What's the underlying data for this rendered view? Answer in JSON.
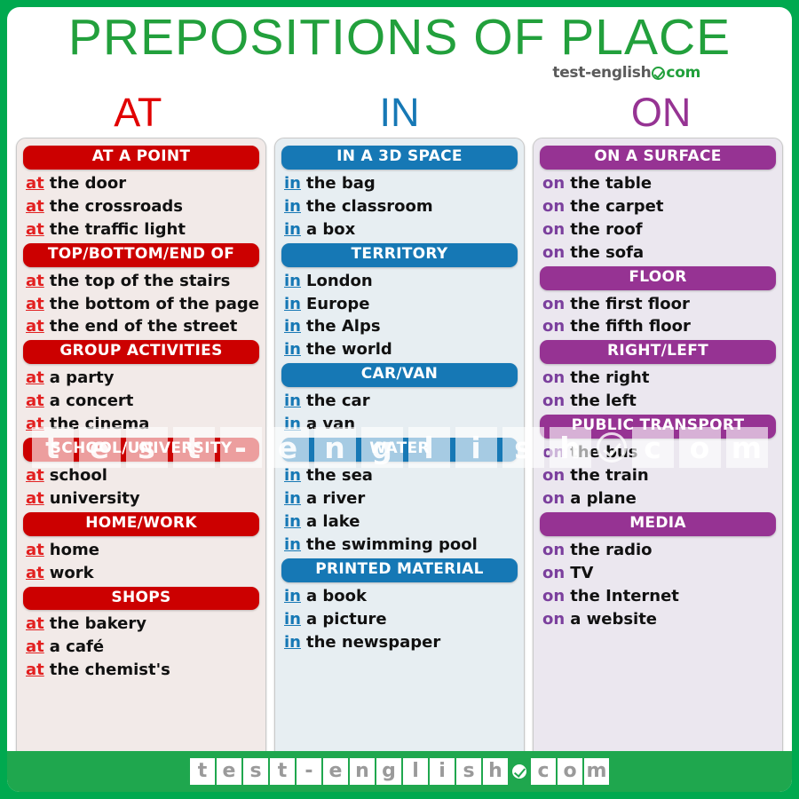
{
  "header": {
    "title": "PREPOSITIONS OF PLACE",
    "logo": {
      "name": "test-english",
      "check_icon": "check-circle-icon",
      "tld": "com"
    },
    "title_color": "#22a03c"
  },
  "columns": [
    {
      "id": "at",
      "title": "AT",
      "title_color": "#e10000",
      "header_color": "#cc0000",
      "panel_color": "#f2eae8",
      "preposition": "at",
      "groups": [
        {
          "header": "AT A POINT",
          "items": [
            "the door",
            "the crossroads",
            "the traffic light"
          ]
        },
        {
          "header": "TOP/BOTTOM/END OF",
          "items": [
            "the top  of the stairs",
            "the bottom of the page",
            "the end of the street"
          ]
        },
        {
          "header": "GROUP ACTIVITIES",
          "items": [
            "a party",
            "a concert",
            "the cinema"
          ]
        },
        {
          "header": "SCHOOL/UNIVERSITY",
          "items": [
            "school",
            "university"
          ]
        },
        {
          "header": "HOME/WORK",
          "items": [
            "home",
            "work"
          ]
        },
        {
          "header": "SHOPS",
          "items": [
            "the bakery",
            "a café",
            "the chemist's"
          ]
        }
      ]
    },
    {
      "id": "in",
      "title": "IN",
      "title_color": "#1678b5",
      "header_color": "#1678b5",
      "panel_color": "#e7eef2",
      "preposition": "in",
      "groups": [
        {
          "header": "IN A 3D SPACE",
          "items": [
            "the bag",
            "the classroom",
            "a box"
          ]
        },
        {
          "header": "TERRITORY",
          "items": [
            "London",
            "Europe",
            "the Alps",
            "the world"
          ]
        },
        {
          "header": "CAR/VAN",
          "items": [
            "the car",
            "a van"
          ]
        },
        {
          "header": "WATER",
          "items": [
            "the sea",
            "a river",
            "a lake",
            "the swimming pool"
          ]
        },
        {
          "header": "PRINTED MATERIAL",
          "items": [
            "a book",
            "a picture",
            "the newspaper"
          ]
        }
      ]
    },
    {
      "id": "on",
      "title": "ON",
      "title_color": "#963393",
      "header_color": "#963393",
      "panel_color": "#ebe7ef",
      "preposition": "on",
      "groups": [
        {
          "header": "ON A SURFACE",
          "items": [
            "the table",
            "the carpet",
            "the roof",
            "the sofa"
          ]
        },
        {
          "header": "FLOOR",
          "items": [
            "the first floor",
            "the fifth floor"
          ]
        },
        {
          "header": "RIGHT/LEFT",
          "items": [
            "the right",
            "the left"
          ]
        },
        {
          "header": "PUBLIC TRANSPORT",
          "items": [
            "the bus",
            "the train",
            "a plane"
          ]
        },
        {
          "header": "MEDIA",
          "items": [
            "the radio",
            "TV",
            "the Internet",
            "a website"
          ]
        }
      ]
    }
  ],
  "watermark": {
    "letters": [
      "t",
      "e",
      "s",
      "t",
      "-",
      "e",
      "n",
      "g",
      "l",
      "i",
      "s",
      "h"
    ],
    "check_icon": "check-circle-icon",
    "tld_letters": [
      "c",
      "o",
      "m"
    ]
  },
  "footer": {
    "letters": [
      "t",
      "e",
      "s",
      "t",
      "-",
      "e",
      "n",
      "g",
      "l",
      "i",
      "s",
      "h"
    ],
    "check_icon": "check-circle-icon",
    "tld_letters": [
      "c",
      "o",
      "m"
    ],
    "background_color": "#1fa74e"
  },
  "border_color": "#00a94f"
}
